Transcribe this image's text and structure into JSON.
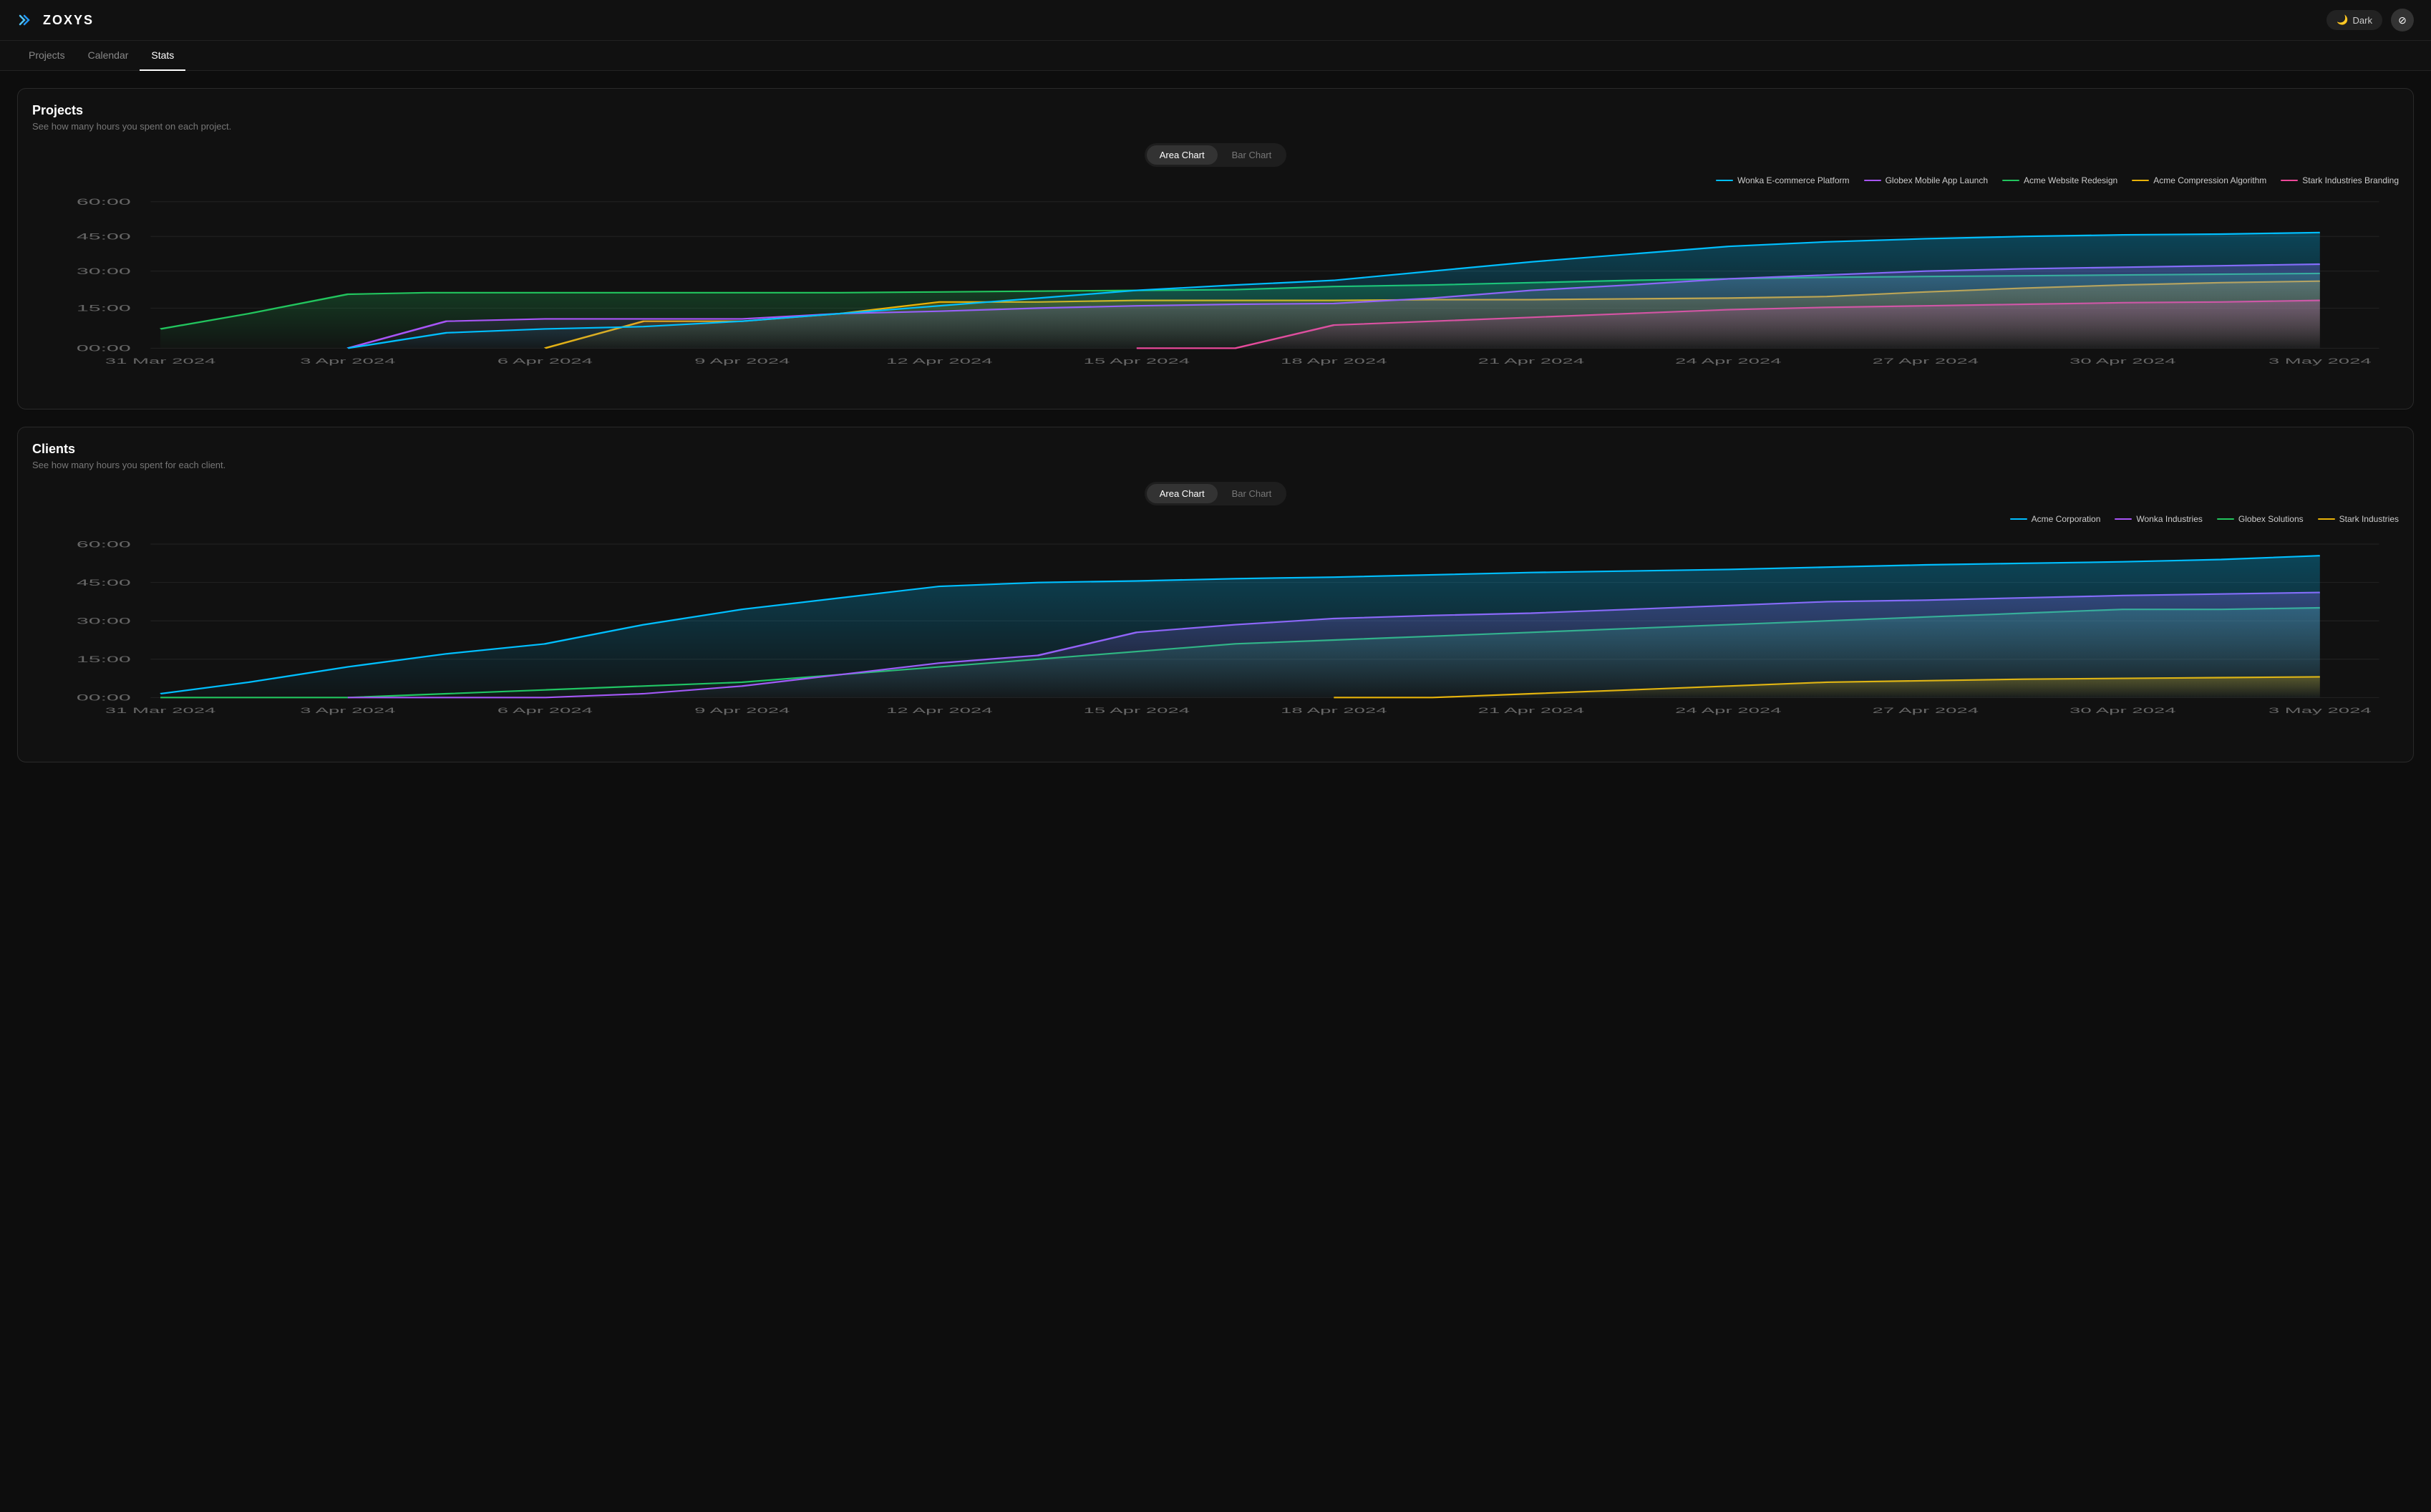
{
  "app": {
    "name": "ZOXYS",
    "theme": "Dark"
  },
  "nav": {
    "items": [
      {
        "label": "Projects",
        "active": false
      },
      {
        "label": "Calendar",
        "active": false
      },
      {
        "label": "Stats",
        "active": true
      }
    ]
  },
  "projects_section": {
    "title": "Projects",
    "subtitle": "See how many hours you spent on each project.",
    "toggle": {
      "area_label": "Area Chart",
      "bar_label": "Bar Chart",
      "active": "area"
    },
    "legend": [
      {
        "label": "Wonka E-commerce Platform",
        "color": "#00bfff"
      },
      {
        "label": "Globex Mobile App Launch",
        "color": "#a855f7"
      },
      {
        "label": "Acme Website Redesign",
        "color": "#22c55e"
      },
      {
        "label": "Acme Compression Algorithm",
        "color": "#eab308"
      },
      {
        "label": "Stark Industries Branding",
        "color": "#ec4899"
      }
    ],
    "y_axis": [
      "60:00",
      "45:00",
      "30:00",
      "15:00",
      "00:00"
    ],
    "x_axis": [
      "31 Mar 2024",
      "3 Apr 2024",
      "6 Apr 2024",
      "9 Apr 2024",
      "12 Apr 2024",
      "15 Apr 2024",
      "18 Apr 2024",
      "21 Apr 2024",
      "24 Apr 2024",
      "27 Apr 2024",
      "30 Apr 2024",
      "3 May 2024"
    ]
  },
  "clients_section": {
    "title": "Clients",
    "subtitle": "See how many hours you spent for each client.",
    "toggle": {
      "area_label": "Area Chart",
      "bar_label": "Bar Chart",
      "active": "area"
    },
    "legend": [
      {
        "label": "Acme Corporation",
        "color": "#00bfff"
      },
      {
        "label": "Wonka Industries",
        "color": "#a855f7"
      },
      {
        "label": "Globex Solutions",
        "color": "#22c55e"
      },
      {
        "label": "Stark Industries",
        "color": "#eab308"
      }
    ],
    "y_axis": [
      "60:00",
      "45:00",
      "30:00",
      "15:00",
      "00:00"
    ],
    "x_axis": [
      "31 Mar 2024",
      "3 Apr 2024",
      "6 Apr 2024",
      "9 Apr 2024",
      "12 Apr 2024",
      "15 Apr 2024",
      "18 Apr 2024",
      "21 Apr 2024",
      "24 Apr 2024",
      "27 Apr 2024",
      "30 Apr 2024",
      "3 May 2024"
    ]
  }
}
